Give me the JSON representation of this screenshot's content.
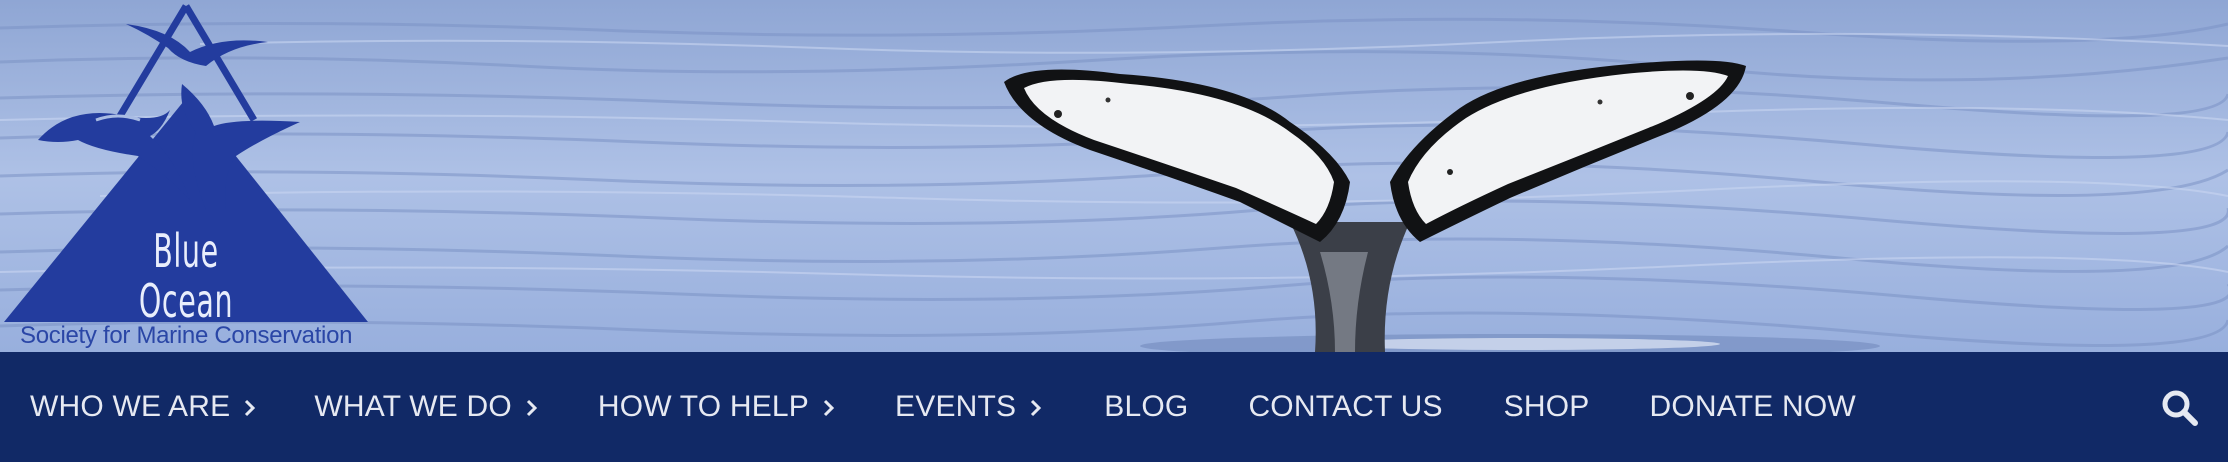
{
  "brand": {
    "name": "Blue Ocean",
    "tagline": "Society for Marine Conservation",
    "logo_icon": "triangle-dolphin-whale-tail-bird-logo",
    "colors": {
      "logo_blue": "#233c9e",
      "nav_background": "#112966",
      "nav_text": "#e6e9f2",
      "water": "#a3b8e2"
    }
  },
  "hero": {
    "image": "whale-tail-over-ocean"
  },
  "nav": {
    "items": [
      {
        "label": "WHO WE ARE",
        "has_submenu": true
      },
      {
        "label": "WHAT WE DO",
        "has_submenu": true
      },
      {
        "label": "HOW TO HELP",
        "has_submenu": true
      },
      {
        "label": "EVENTS",
        "has_submenu": true
      },
      {
        "label": "BLOG",
        "has_submenu": false
      },
      {
        "label": "CONTACT US",
        "has_submenu": false
      },
      {
        "label": "SHOP",
        "has_submenu": false
      },
      {
        "label": "DONATE NOW",
        "has_submenu": false
      }
    ],
    "search_icon": "search-icon"
  }
}
